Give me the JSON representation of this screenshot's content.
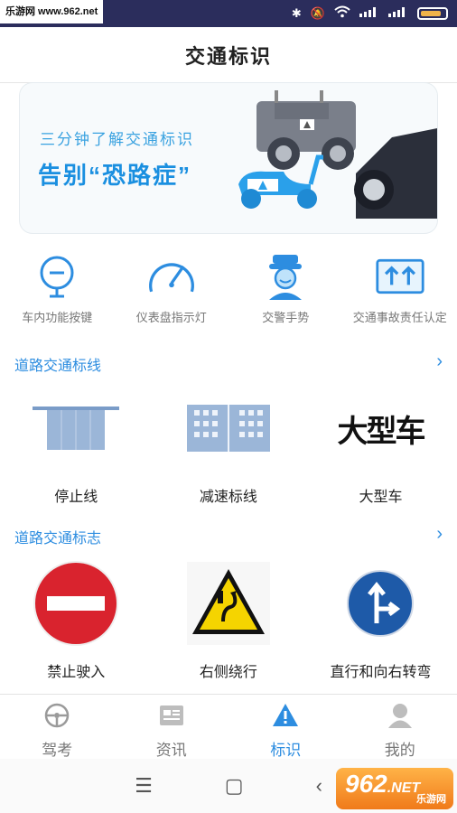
{
  "status_bar": {
    "watermark": "乐游网 www.962.net",
    "battery_level": 0.85,
    "icons": [
      "bluetooth-icon",
      "mute-icon",
      "wifi-icon",
      "signal-icon",
      "signal-icon",
      "battery-icon"
    ]
  },
  "header": {
    "title": "交通标识"
  },
  "banner": {
    "subtitle": "三分钟了解交通标识",
    "headline": "告别“恐路症”"
  },
  "categories": [
    {
      "label": "车内功能按键",
      "icon": "steering-button-icon"
    },
    {
      "label": "仪表盘指示灯",
      "icon": "speedometer-icon"
    },
    {
      "label": "交警手势",
      "icon": "traffic-police-icon"
    },
    {
      "label": "交通事故责任认定",
      "icon": "accident-arrows-icon"
    }
  ],
  "section_markings": {
    "title": "道路交通标线",
    "items": [
      {
        "label": "停止线"
      },
      {
        "label": "减速标线"
      },
      {
        "label": "大型车",
        "image_text": "大型车"
      }
    ]
  },
  "section_signs": {
    "title": "道路交通标志",
    "items": [
      {
        "label": "禁止驶入"
      },
      {
        "label": "右侧绕行"
      },
      {
        "label": "直行和向右转弯"
      }
    ]
  },
  "tabs": [
    {
      "label": "驾考",
      "icon": "steering-wheel-icon",
      "active": false
    },
    {
      "label": "资讯",
      "icon": "news-icon",
      "active": false
    },
    {
      "label": "标识",
      "icon": "warning-sign-icon",
      "active": true
    },
    {
      "label": "我的",
      "icon": "user-icon",
      "active": false
    }
  ],
  "watermark_logo": {
    "number": "962",
    "suffix": ".NET",
    "site": "乐游网"
  },
  "colors": {
    "accent": "#2d8de0",
    "status_bar": "#2b2d5c",
    "sign_red": "#d9232e",
    "sign_blue": "#1e5aa8",
    "sign_yellow": "#f5d400"
  }
}
